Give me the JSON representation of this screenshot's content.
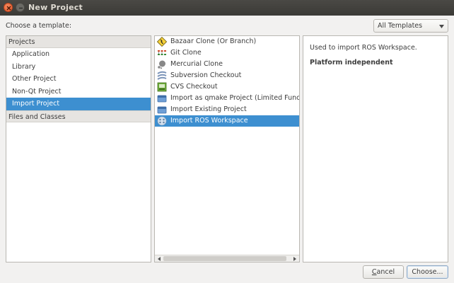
{
  "window": {
    "title": "New Project"
  },
  "header": {
    "choose_label": "Choose a template:",
    "filter_value": "All Templates"
  },
  "categories": {
    "projects_header": "Projects",
    "items": [
      {
        "label": "Application"
      },
      {
        "label": "Library"
      },
      {
        "label": "Other Project"
      },
      {
        "label": "Non-Qt Project"
      },
      {
        "label": "Import Project",
        "selected": true
      }
    ],
    "files_header": "Files and Classes"
  },
  "templates": {
    "items": [
      {
        "label": "Bazaar Clone (Or Branch)",
        "icon": "bazaar-icon"
      },
      {
        "label": "Git Clone",
        "icon": "git-icon"
      },
      {
        "label": "Mercurial Clone",
        "icon": "mercurial-icon"
      },
      {
        "label": "Subversion Checkout",
        "icon": "subversion-icon"
      },
      {
        "label": "CVS Checkout",
        "icon": "cvs-icon"
      },
      {
        "label": "Import as qmake Project (Limited Functionality)",
        "icon": "folder-icon"
      },
      {
        "label": "Import Existing Project",
        "icon": "folder-icon"
      },
      {
        "label": "Import ROS Workspace",
        "icon": "ros-icon",
        "selected": true
      }
    ]
  },
  "description": {
    "text": "Used to import ROS Workspace.",
    "platform": "Platform independent"
  },
  "buttons": {
    "cancel": "Cancel",
    "choose": "Choose..."
  },
  "colors": {
    "selection": "#3d8fd0",
    "titlebar": "#3b3a36",
    "close_button": "#e4572b"
  }
}
